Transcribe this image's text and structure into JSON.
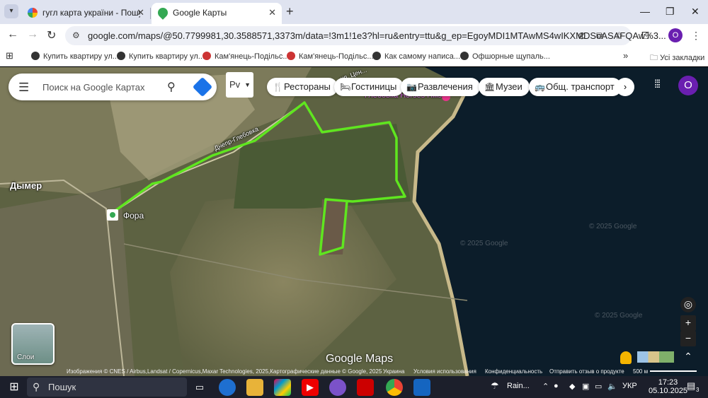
{
  "browser": {
    "tabs": [
      {
        "title": "гугл карта україни - Пошук у Google",
        "active": false
      },
      {
        "title": "Google Карты",
        "active": true
      }
    ],
    "url": "google.com/maps/@50.7799981,30.3588571,3373m/data=!3m1!1e3?hl=ru&entry=ttu&g_ep=EgoyMDI1MTAwMS4wIKXMDSoASAFQAw%3...",
    "bookmarks": [
      "Купить квартиру ул...",
      "Купить квартиру ул...",
      "Кам'янець-Подільс...",
      "Кам'янець-Подільс...",
      "Как самому написа...",
      "Офшорные щупаль..."
    ],
    "bookmarks_more": "»",
    "all_bookmarks": "Усі закладки",
    "profile_initial": "O"
  },
  "map": {
    "search_placeholder": "Поиск на Google Картах",
    "select_value": "Рv",
    "chips": [
      {
        "label": "Рестораны",
        "icon": "restaurant-icon"
      },
      {
        "label": "Гостиницы",
        "icon": "hotel-icon"
      },
      {
        "label": "Развлечения",
        "icon": "camera-icon"
      },
      {
        "label": "Музеи",
        "icon": "museum-icon"
      },
      {
        "label": "Общ. транспорт",
        "icon": "bus-icon"
      }
    ],
    "avatar_initial": "O",
    "labels": {
      "town": "Дымер",
      "store": "Фора",
      "road": "Днепр-Глебовка",
      "street": "ул. Цен...",
      "hills": "Глебовка Horses Hills"
    },
    "watermark": "© 2025 Google",
    "layers_label": "Слои",
    "logo": "Google Maps",
    "attribution": "Изображения © CNES / Airbus,Landsat / Copernicus,Maxar Technologies, 2025,Картографические данные © Google, 2025",
    "country": "Украина",
    "terms": "Условия использования",
    "privacy": "Конфиденциальность",
    "feedback": "Отправить отзыв о продукте",
    "scale": "500 м"
  },
  "taskbar": {
    "search_label": "Пошук",
    "weather": "Rain...",
    "language": "УКР",
    "time": "17:23",
    "date": "05.10.2025",
    "notifications": "3"
  },
  "colors": {
    "route": "#5fe61f",
    "water": "#0c1d2a",
    "brand": "#1a73e8"
  }
}
